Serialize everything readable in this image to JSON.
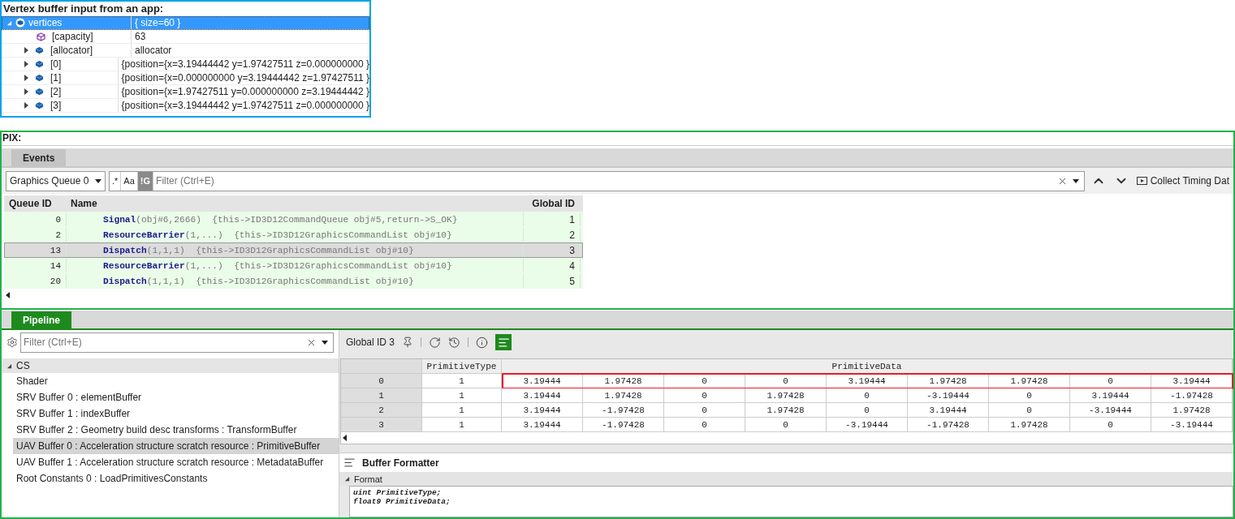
{
  "vertex_panel": {
    "title": "Vertex buffer input from  an app:",
    "root": {
      "name": "vertices",
      "value": "{ size=60 }",
      "expanded": true,
      "selected": true,
      "children": [
        {
          "name": "[capacity]",
          "value": "63",
          "kind": "property"
        },
        {
          "name": "[allocator]",
          "value": "allocator",
          "kind": "object",
          "expanded": false
        },
        {
          "name": "[0]",
          "value": "{position={x=3.19444442 y=1.97427511 z=0.000000000 }",
          "kind": "object",
          "expanded": false
        },
        {
          "name": "[1]",
          "value": "{position={x=0.000000000 y=3.19444442 z=1.97427511 }",
          "kind": "object",
          "expanded": false
        },
        {
          "name": "[2]",
          "value": "{position={x=1.97427511 y=0.000000000 z=3.19444442 }",
          "kind": "object",
          "expanded": false
        },
        {
          "name": "[3]",
          "value": "{position={x=3.19444442 y=1.97427511 z=0.000000000 }",
          "kind": "object",
          "expanded": false
        }
      ]
    }
  },
  "pix": {
    "label": "PIX:",
    "events": {
      "tab": {
        "label": "Events",
        "focused": false
      },
      "queue": "Graphics Queue 0",
      "toggles": [
        {
          "label": ".*",
          "on": false
        },
        {
          "label": "Aa",
          "on": false
        },
        {
          "label": "!G",
          "on": true
        }
      ],
      "filter": {
        "placeholder": "Filter (Ctrl+E)"
      },
      "collect_timing": "Collect Timing Dat",
      "columns": [
        "Queue ID",
        "Name",
        "Global ID"
      ],
      "rows": [
        {
          "queue_id": "0",
          "function": "Signal",
          "args": "(obj#6,2666)",
          "details": "{this->ID3D12CommandQueue obj#5,return->S_OK}",
          "global_id": "1",
          "selected": false
        },
        {
          "queue_id": "2",
          "function": "ResourceBarrier",
          "args": "(1,...)",
          "details": "{this->ID3D12GraphicsCommandList obj#10}",
          "global_id": "2",
          "selected": false
        },
        {
          "queue_id": "13",
          "function": "Dispatch",
          "args": "(1,1,1)",
          "details": "{this->ID3D12GraphicsCommandList obj#10}",
          "global_id": "3",
          "selected": true
        },
        {
          "queue_id": "14",
          "function": "ResourceBarrier",
          "args": "(1,...)",
          "details": "{this->ID3D12GraphicsCommandList obj#10}",
          "global_id": "4",
          "selected": false
        },
        {
          "queue_id": "20",
          "function": "Dispatch",
          "args": "(1,1,1)",
          "details": "{this->ID3D12GraphicsCommandList obj#10}",
          "global_id": "5",
          "selected": false
        }
      ]
    },
    "pipeline": {
      "tab": {
        "label": "Pipeline",
        "focused": true
      },
      "filter": {
        "placeholder": "Filter (Ctrl+E)"
      },
      "tree": {
        "label": "CS",
        "expanded": true,
        "children": [
          {
            "label": "Shader",
            "selected": false
          },
          {
            "label": "SRV Buffer 0 : elementBuffer",
            "selected": false
          },
          {
            "label": "SRV Buffer 1 : indexBuffer",
            "selected": false
          },
          {
            "label": "SRV Buffer 2 : Geometry build desc transforms : TransformBuffer",
            "selected": false
          },
          {
            "label": "UAV Buffer 0 : Acceleration structure scratch resource : PrimitiveBuffer",
            "selected": true
          },
          {
            "label": "UAV Buffer 1 : Acceleration structure scratch resource : MetadataBuffer",
            "selected": false
          },
          {
            "label": "Root Constants 0 : LoadPrimitivesConstants",
            "selected": false
          }
        ]
      },
      "global_id": "Global ID 3",
      "format_view_on": true,
      "grid": {
        "columns": [
          "PrimitiveType",
          "PrimitiveData"
        ],
        "rows": [
          {
            "index": "0",
            "type": "1",
            "data": [
              "3.19444",
              "1.97428",
              "0",
              "0",
              "3.19444",
              "1.97428",
              "1.97428",
              "0",
              "3.19444"
            ],
            "highlighted": true
          },
          {
            "index": "1",
            "type": "1",
            "data": [
              "3.19444",
              "1.97428",
              "0",
              "1.97428",
              "0",
              "-3.19444",
              "0",
              "3.19444",
              "-1.97428"
            ],
            "highlighted": false
          },
          {
            "index": "2",
            "type": "1",
            "data": [
              "3.19444",
              "-1.97428",
              "0",
              "1.97428",
              "0",
              "3.19444",
              "0",
              "-3.19444",
              "1.97428"
            ],
            "highlighted": false
          },
          {
            "index": "3",
            "type": "1",
            "data": [
              "3.19444",
              "-1.97428",
              "0",
              "0",
              "-3.19444",
              "-1.97428",
              "1.97428",
              "0",
              "-3.19444"
            ],
            "highlighted": false
          }
        ]
      },
      "formatter": {
        "title": "Buffer Formatter",
        "section": "Format",
        "expanded": true,
        "code": [
          "uint PrimitiveType;",
          "float9 PrimitiveData;"
        ]
      }
    }
  }
}
